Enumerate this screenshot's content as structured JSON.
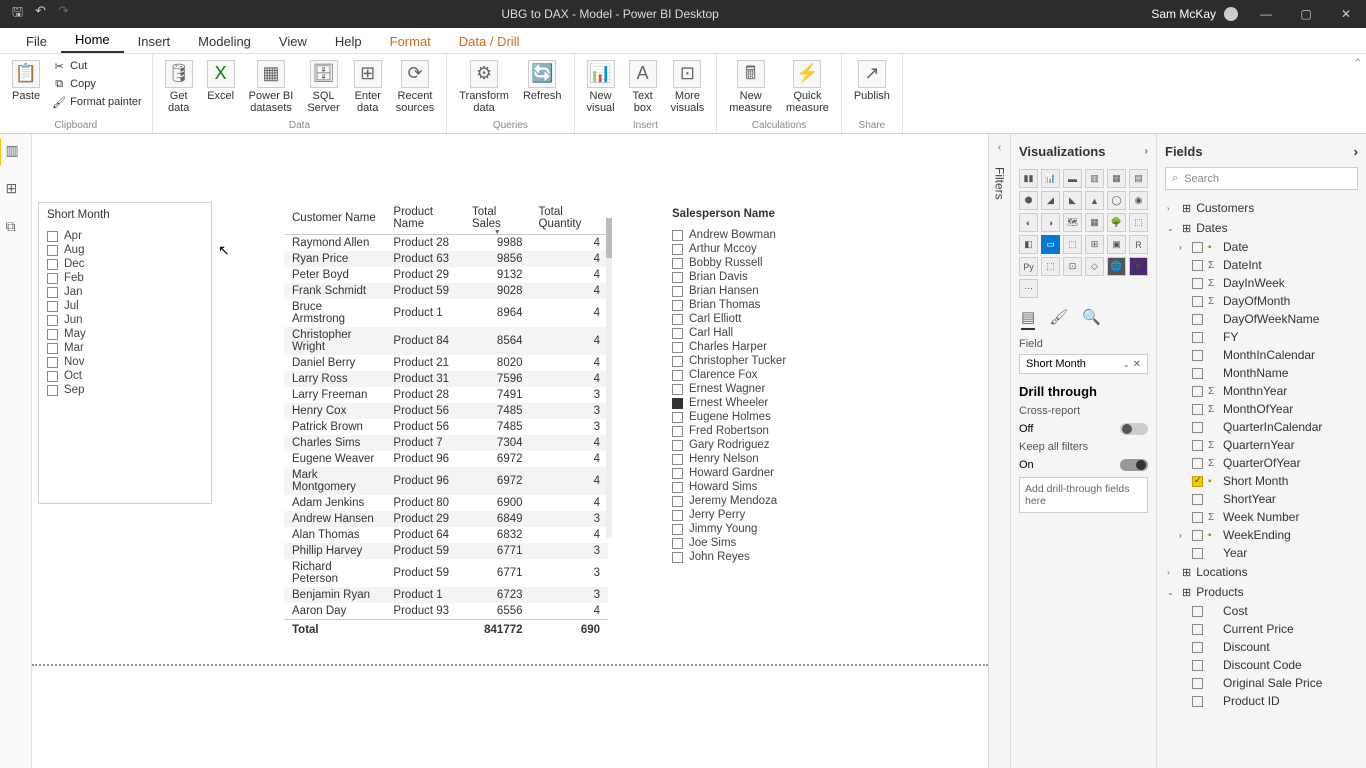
{
  "titlebar": {
    "title": "UBG to DAX - Model - Power BI Desktop",
    "user": "Sam McKay"
  },
  "menutabs": [
    "File",
    "Home",
    "Insert",
    "Modeling",
    "View",
    "Help",
    "Format",
    "Data / Drill"
  ],
  "ribbon": {
    "clipboard": {
      "label": "Clipboard",
      "paste": "Paste",
      "cut": "Cut",
      "copy": "Copy",
      "painter": "Format painter"
    },
    "data": {
      "label": "Data",
      "get": "Get\ndata",
      "excel": "Excel",
      "pbi": "Power BI\ndatasets",
      "sql": "SQL\nServer",
      "enter": "Enter\ndata",
      "recent": "Recent\nsources"
    },
    "queries": {
      "label": "Queries",
      "transform": "Transform\ndata",
      "refresh": "Refresh"
    },
    "insert": {
      "label": "Insert",
      "visual": "New\nvisual",
      "textbox": "Text\nbox",
      "more": "More\nvisuals"
    },
    "calc": {
      "label": "Calculations",
      "measure": "New\nmeasure",
      "quick": "Quick\nmeasure"
    },
    "share": {
      "label": "Share",
      "publish": "Publish"
    }
  },
  "slicer_month": {
    "title": "Short Month",
    "items": [
      "Apr",
      "Aug",
      "Dec",
      "Feb",
      "Jan",
      "Jul",
      "Jun",
      "May",
      "Mar",
      "Nov",
      "Oct",
      "Sep"
    ]
  },
  "table": {
    "headers": [
      "Customer Name",
      "Product Name",
      "Total Sales",
      "Total Quantity"
    ],
    "rows": [
      [
        "Raymond Allen",
        "Product 28",
        "9988",
        "4"
      ],
      [
        "Ryan Price",
        "Product 63",
        "9856",
        "4"
      ],
      [
        "Peter Boyd",
        "Product 29",
        "9132",
        "4"
      ],
      [
        "Frank Schmidt",
        "Product 59",
        "9028",
        "4"
      ],
      [
        "Bruce Armstrong",
        "Product 1",
        "8964",
        "4"
      ],
      [
        "Christopher Wright",
        "Product 84",
        "8564",
        "4"
      ],
      [
        "Daniel Berry",
        "Product 21",
        "8020",
        "4"
      ],
      [
        "Larry Ross",
        "Product 31",
        "7596",
        "4"
      ],
      [
        "Larry Freeman",
        "Product 28",
        "7491",
        "3"
      ],
      [
        "Henry Cox",
        "Product 56",
        "7485",
        "3"
      ],
      [
        "Patrick Brown",
        "Product 56",
        "7485",
        "3"
      ],
      [
        "Charles Sims",
        "Product 7",
        "7304",
        "4"
      ],
      [
        "Eugene Weaver",
        "Product 96",
        "6972",
        "4"
      ],
      [
        "Mark Montgomery",
        "Product 96",
        "6972",
        "4"
      ],
      [
        "Adam Jenkins",
        "Product 80",
        "6900",
        "4"
      ],
      [
        "Andrew Hansen",
        "Product 29",
        "6849",
        "3"
      ],
      [
        "Alan Thomas",
        "Product 64",
        "6832",
        "4"
      ],
      [
        "Phillip Harvey",
        "Product 59",
        "6771",
        "3"
      ],
      [
        "Richard Peterson",
        "Product 59",
        "6771",
        "3"
      ],
      [
        "Benjamin Ryan",
        "Product 1",
        "6723",
        "3"
      ],
      [
        "Aaron Day",
        "Product 93",
        "6556",
        "4"
      ]
    ],
    "total": [
      "Total",
      "",
      "841772",
      "690"
    ]
  },
  "slicer_sales": {
    "title": "Salesperson Name",
    "items": [
      "Andrew Bowman",
      "Arthur Mccoy",
      "Bobby Russell",
      "Brian Davis",
      "Brian Hansen",
      "Brian Thomas",
      "Carl Elliott",
      "Carl Hall",
      "Charles Harper",
      "Christopher Tucker",
      "Clarence Fox",
      "Ernest Wagner",
      "Ernest Wheeler",
      "Eugene Holmes",
      "Fred Robertson",
      "Gary Rodriguez",
      "Henry Nelson",
      "Howard Gardner",
      "Howard Sims",
      "Jeremy Mendoza",
      "Jerry Perry",
      "Jimmy Young",
      "Joe Sims",
      "John Reyes"
    ],
    "selected_index": 12
  },
  "filters_label": "Filters",
  "vizpane": {
    "title": "Visualizations",
    "field_label": "Field",
    "field_value": "Short Month",
    "drill_title": "Drill through",
    "cross_report": "Cross-report",
    "off": "Off",
    "keep_filters": "Keep all filters",
    "on": "On",
    "dropzone": "Add drill-through fields here",
    "icons": [
      "▮▮",
      "📊",
      "▬",
      "▥",
      "▦",
      "▤",
      "⬢",
      "◢",
      "◣",
      "▲",
      "◯",
      "◉",
      "◐",
      "◑",
      "🗺",
      "▦",
      "🌳",
      "⬚",
      "◧",
      "▭",
      "⬚",
      "⊞",
      "▣",
      "R",
      "Py",
      "⬚",
      "⊡",
      "◇",
      "🌐",
      "◾",
      "⋯"
    ]
  },
  "fieldspane": {
    "title": "Fields",
    "search": "Search",
    "tables": [
      {
        "name": "Customers",
        "expanded": false
      },
      {
        "name": "Dates",
        "expanded": true,
        "cols": [
          {
            "name": "Date",
            "hier": true,
            "expandable": true
          },
          {
            "name": "DateInt",
            "sigma": true
          },
          {
            "name": "DayInWeek",
            "sigma": true
          },
          {
            "name": "DayOfMonth",
            "sigma": true
          },
          {
            "name": "DayOfWeekName"
          },
          {
            "name": "FY"
          },
          {
            "name": "MonthInCalendar"
          },
          {
            "name": "MonthName"
          },
          {
            "name": "MonthnYear",
            "sigma": true
          },
          {
            "name": "MonthOfYear",
            "sigma": true
          },
          {
            "name": "QuarterInCalendar"
          },
          {
            "name": "QuarternYear",
            "sigma": true
          },
          {
            "name": "QuarterOfYear",
            "sigma": true
          },
          {
            "name": "Short Month",
            "checked": true,
            "hier": true
          },
          {
            "name": "ShortYear"
          },
          {
            "name": "Week Number",
            "sigma": true
          },
          {
            "name": "WeekEnding",
            "hier": true,
            "expandable": true
          },
          {
            "name": "Year"
          }
        ]
      },
      {
        "name": "Locations",
        "expanded": false
      },
      {
        "name": "Products",
        "expanded": true,
        "cols": [
          {
            "name": "Cost"
          },
          {
            "name": "Current Price"
          },
          {
            "name": "Discount"
          },
          {
            "name": "Discount Code"
          },
          {
            "name": "Original Sale Price"
          },
          {
            "name": "Product ID"
          }
        ]
      }
    ]
  }
}
